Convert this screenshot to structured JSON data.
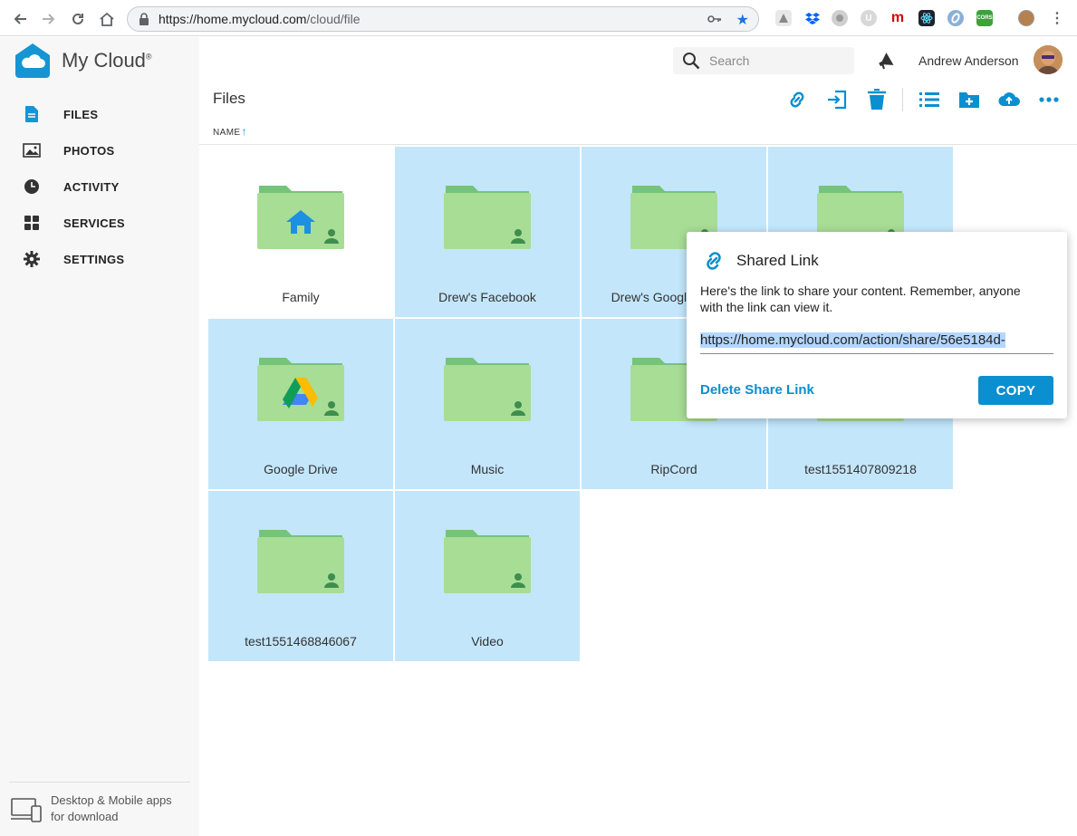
{
  "browser": {
    "url_host": "https://home.mycloud.com",
    "url_path": "/cloud/file",
    "extensions": [
      {
        "name": "dropbox-icon",
        "label": "",
        "color": "#0061ff"
      },
      {
        "name": "m-icon",
        "label": "m",
        "color": "#d50000"
      },
      {
        "name": "react-icon",
        "label": "",
        "color": "#61dafb"
      },
      {
        "name": "cors-icon",
        "label": "CORS",
        "color": "#3aa33a"
      }
    ]
  },
  "app": {
    "brand": "My Cloud",
    "brand_mark": "®"
  },
  "sidebar": {
    "items": [
      {
        "label": "FILES",
        "icon": "file-icon"
      },
      {
        "label": "PHOTOS",
        "icon": "photo-icon"
      },
      {
        "label": "ACTIVITY",
        "icon": "clock-icon"
      },
      {
        "label": "SERVICES",
        "icon": "grid-icon"
      },
      {
        "label": "SETTINGS",
        "icon": "gear-icon"
      }
    ],
    "download_text": "Desktop & Mobile apps for download"
  },
  "header": {
    "search_placeholder": "Search",
    "user_name": "Andrew Anderson"
  },
  "main": {
    "title": "Files",
    "column_header": "NAME",
    "sort_arrow": "↑",
    "toolbar": [
      "link-icon",
      "move-icon",
      "trash-icon",
      "list-view-icon",
      "new-folder-icon",
      "upload-icon",
      "more-icon"
    ],
    "folders": [
      {
        "name": "Family",
        "selected": false,
        "badge": "home"
      },
      {
        "name": "Drew's Facebook",
        "selected": true,
        "badge": "none"
      },
      {
        "name": "Drew's Google Photos",
        "selected": true,
        "badge": "none"
      },
      {
        "name": "",
        "selected": true,
        "badge": "none"
      },
      {
        "name": "Google Drive",
        "selected": true,
        "badge": "drive"
      },
      {
        "name": "Music",
        "selected": true,
        "badge": "none"
      },
      {
        "name": "RipCord",
        "selected": true,
        "badge": "none"
      },
      {
        "name": "test1551407809218",
        "selected": true,
        "badge": "none"
      },
      {
        "name": "test1551468846067",
        "selected": true,
        "badge": "none"
      },
      {
        "name": "Video",
        "selected": true,
        "badge": "none"
      }
    ]
  },
  "popover": {
    "title": "Shared Link",
    "description": "Here's the link to share your content. Remember, anyone with the link can view it.",
    "link": "https://home.mycloud.com/action/share/56e5184d-",
    "delete_label": "Delete Share Link",
    "copy_label": "COPY"
  },
  "colors": {
    "accent": "#0a8fd0",
    "selected_tile": "#c3e6fb",
    "folder": "#a8dd96",
    "folder_tab": "#74c47a"
  }
}
